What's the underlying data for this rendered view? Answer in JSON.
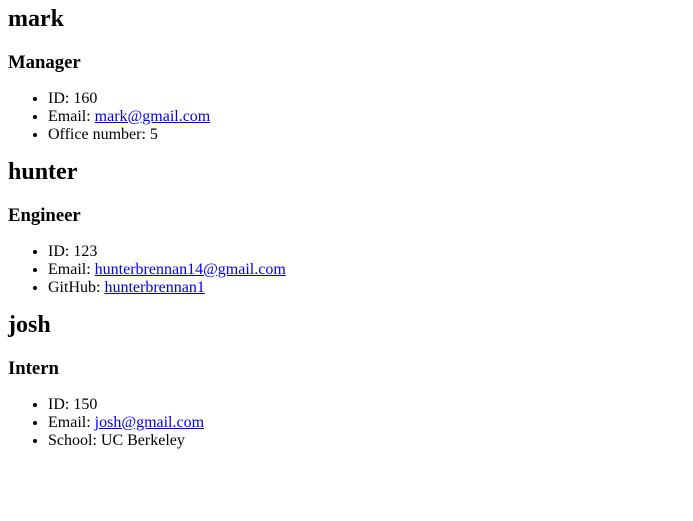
{
  "employees": [
    {
      "name": "mark",
      "role": "Manager",
      "id_label": "ID: ",
      "id": "160",
      "email_label": "Email: ",
      "email": "mark@gmail.com",
      "extra_label": "Office number: ",
      "extra_value": "5"
    },
    {
      "name": "hunter",
      "role": "Engineer",
      "id_label": "ID: ",
      "id": "123",
      "email_label": "Email: ",
      "email": "hunterbrennan14@gmail.com",
      "extra_label": "GitHub: ",
      "extra_value": "hunterbrennan1"
    },
    {
      "name": "josh",
      "role": "Intern",
      "id_label": "ID: ",
      "id": "150",
      "email_label": "Email: ",
      "email": "josh@gmail.com",
      "extra_label": "School: ",
      "extra_value": "UC Berkeley"
    }
  ]
}
